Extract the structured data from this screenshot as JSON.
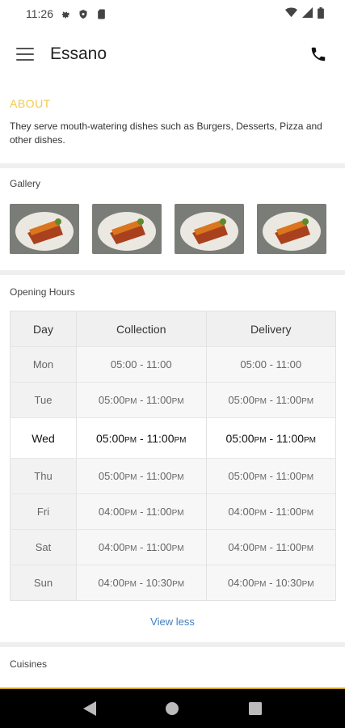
{
  "status": {
    "time": "11:26"
  },
  "header": {
    "title": "Essano"
  },
  "about": {
    "heading": "ABOUT",
    "text": "They serve mouth-watering dishes such as Burgers, Desserts, Pizza and other dishes."
  },
  "gallery": {
    "label": "Gallery",
    "image_count": 4
  },
  "hours": {
    "label": "Opening Hours",
    "columns": [
      "Day",
      "Collection",
      "Delivery"
    ],
    "rows": [
      {
        "day": "Mon",
        "c_open": "05:00",
        "c_open_suffix": "",
        "c_close": "- 11:00",
        "c_close_suffix": "",
        "d_open": "05:00",
        "d_open_suffix": "",
        "d_close": "- 11:00",
        "d_close_suffix": ""
      },
      {
        "day": "Tue",
        "c_open": "05:00",
        "c_open_suffix": "PM",
        "c_close": "- 11:00",
        "c_close_suffix": "PM",
        "d_open": "05:00",
        "d_open_suffix": "PM",
        "d_close": "- 11:00",
        "d_close_suffix": "PM"
      },
      {
        "day": "Wed",
        "c_open": "05:00",
        "c_open_suffix": "PM",
        "c_close": "- 11:00",
        "c_close_suffix": "PM",
        "d_open": "05:00",
        "d_open_suffix": "PM",
        "d_close": "- 11:00",
        "d_close_suffix": "PM"
      },
      {
        "day": "Thu",
        "c_open": "05:00",
        "c_open_suffix": "PM",
        "c_close": "- 11:00",
        "c_close_suffix": "PM",
        "d_open": "05:00",
        "d_open_suffix": "PM",
        "d_close": "- 11:00",
        "d_close_suffix": "PM"
      },
      {
        "day": "Fri",
        "c_open": "04:00",
        "c_open_suffix": "PM",
        "c_close": "- 11:00",
        "c_close_suffix": "PM",
        "d_open": "04:00",
        "d_open_suffix": "PM",
        "d_close": "- 11:00",
        "d_close_suffix": "PM"
      },
      {
        "day": "Sat",
        "c_open": "04:00",
        "c_open_suffix": "PM",
        "c_close": "- 11:00",
        "c_close_suffix": "PM",
        "d_open": "04:00",
        "d_open_suffix": "PM",
        "d_close": "- 11:00",
        "d_close_suffix": "PM"
      },
      {
        "day": "Sun",
        "c_open": "04:00",
        "c_open_suffix": "PM",
        "c_close": "- 10:30",
        "c_close_suffix": "PM",
        "d_open": "04:00",
        "d_open_suffix": "PM",
        "d_close": "- 10:30",
        "d_close_suffix": "PM"
      }
    ],
    "today": "Wed",
    "toggle_label": "View less"
  },
  "cuisines": {
    "label": "Cuisines"
  },
  "colors": {
    "accent": "#f2c94c",
    "link": "#3f7fbf",
    "divider": "#efefef"
  },
  "icons": {
    "status": [
      "gear-icon",
      "shield-icon",
      "sim-card-icon",
      "wifi-icon",
      "signal-icon",
      "battery-icon"
    ],
    "header": [
      "menu-icon",
      "phone-icon"
    ],
    "nav": [
      "back-icon",
      "home-icon",
      "recents-icon"
    ]
  }
}
